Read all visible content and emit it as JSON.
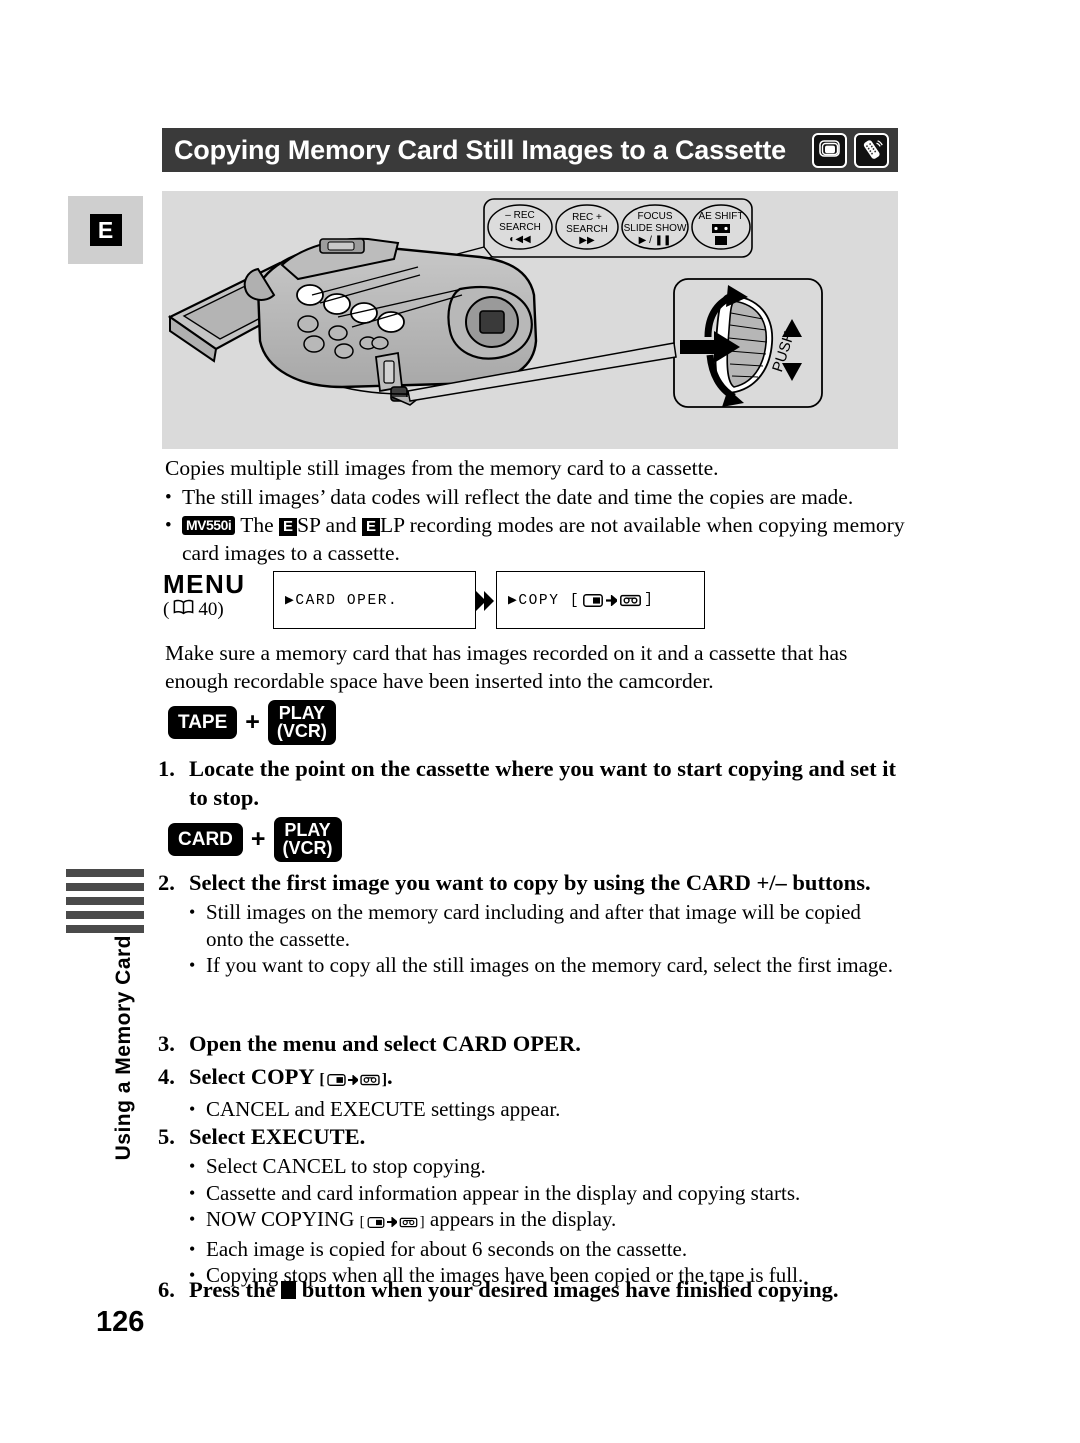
{
  "header": {
    "title": "Copying Memory Card Still Images to a Cassette",
    "icon_card_name": "still-image-card-icon",
    "icon_remote_name": "remote-control-icon"
  },
  "tab": {
    "label": "E"
  },
  "illustration": {
    "remote_buttons": [
      {
        "line1": "–  REC",
        "line2": "SEARCH",
        "line3": "◄◄"
      },
      {
        "line1": "REC  +",
        "line2": "SEARCH",
        "line3": "►►"
      },
      {
        "line1": "FOCUS",
        "line2": "SLIDE SHOW",
        "line3": "► / ▐▐"
      },
      {
        "line1": "AE SHIFT",
        "line2": "",
        "line3": "■"
      }
    ],
    "dial_label": "PUSH"
  },
  "intro": {
    "lead": "Copies multiple still images from the memory card to a cassette.",
    "bullets": [
      {
        "prefix": "",
        "text": "The still images’ data codes will reflect the date and time the copies are made."
      },
      {
        "prefix": "MV550i",
        "text_a": "The",
        "mode_a": "E",
        "text_b": "SP and",
        "mode_b": "E",
        "text_c": "LP recording modes are not available when copying memory card images to a cassette."
      }
    ]
  },
  "menu": {
    "word": "MENU",
    "ref_open": "(",
    "ref_page": "40)",
    "box1": "▶CARD OPER.",
    "box2_prefix": "▶COPY [",
    "box2_suffix": "]"
  },
  "precondition": "Make sure a memory card that has images recorded on it and a cassette that has enough recordable space have been inserted into the camcorder.",
  "keys": {
    "tape": "TAPE",
    "card": "CARD",
    "play_line1": "PLAY",
    "play_line2": "(VCR)",
    "plus": "+"
  },
  "steps": [
    {
      "num": "1.",
      "head": "Locate the point on the cassette where you want to start copying and set it to stop.",
      "subs": []
    },
    {
      "num": "2.",
      "head": "Select the first image you want to copy by using the CARD +/– buttons.",
      "subs": [
        "Still images on the memory card including and after that image will be copied onto the cassette.",
        "If you want to copy all the still images on the memory card, select the first image."
      ]
    },
    {
      "num": "3.",
      "head": "Open the menu and select CARD OPER.",
      "subs": []
    },
    {
      "num": "4.",
      "head_prefix": "Select COPY",
      "head_suffix": ".",
      "subs": [
        "CANCEL and EXECUTE settings appear."
      ]
    },
    {
      "num": "5.",
      "head": "Select EXECUTE.",
      "subs": [
        "Select CANCEL to stop copying.",
        "Cassette and card information appear in the display and copying starts.",
        "NOW COPYING   appears in the display.",
        "Each image is copied for about 6 seconds on the cassette.",
        "Copying stops when all the images have been copied or the tape is full."
      ],
      "sub_now_copying_a": "NOW COPYING",
      "sub_now_copying_b": "appears in the display."
    },
    {
      "num": "6.",
      "head_a": "Press the",
      "head_b": "button when your desired images have finished copying.",
      "subs": []
    }
  ],
  "sidebar": {
    "chapter": "Using a Memory Card",
    "page_number": "126",
    "bar_count": 5
  },
  "colors": {
    "title_bar": "#3a3a3a",
    "illustration_bg": "#dadada",
    "tab_bg": "#cfcfcf",
    "sidebar_bar": "#4a4a4a",
    "ink": "#000000"
  }
}
